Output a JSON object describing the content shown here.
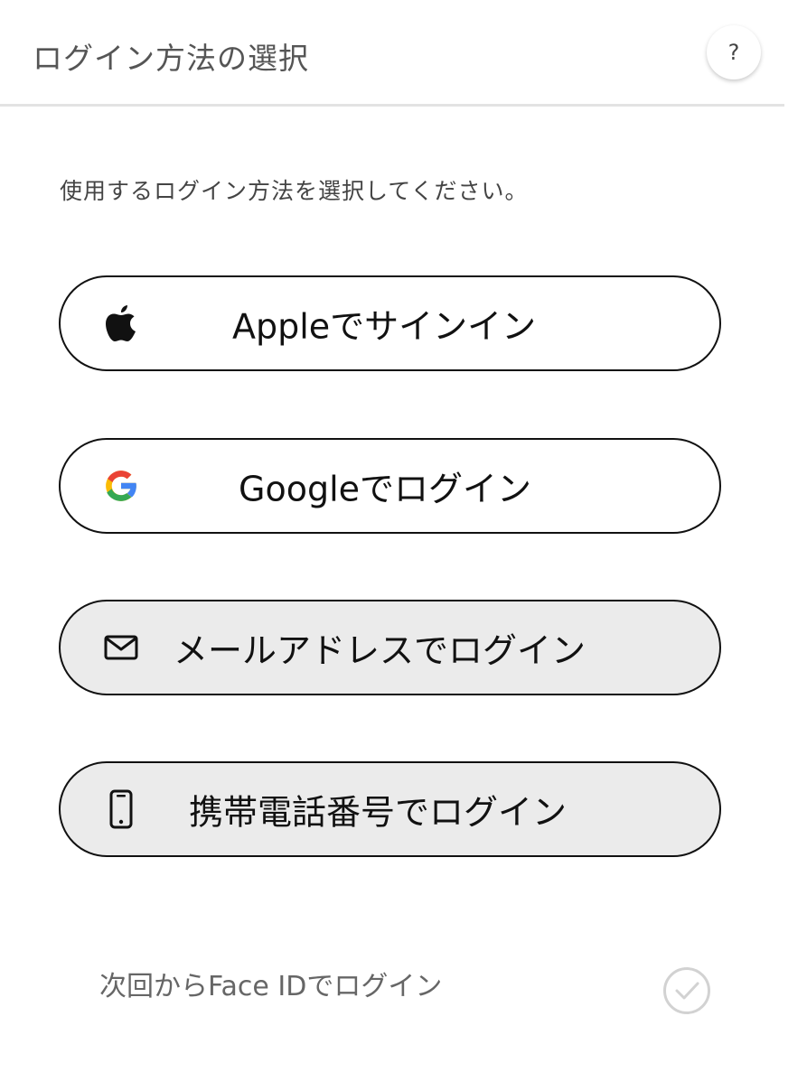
{
  "header": {
    "title": "ログイン方法の選択",
    "help_label": "?"
  },
  "instruction": "使用するログイン方法を選択してください。",
  "login_options": [
    {
      "label": "Appleでサインイン",
      "icon": "apple-icon"
    },
    {
      "label": "Googleでログイン",
      "icon": "google-icon"
    },
    {
      "label": "メールアドレスでログイン",
      "icon": "mail-icon"
    },
    {
      "label": "携帯電話番号でログイン",
      "icon": "phone-icon"
    }
  ],
  "faceid": {
    "label": "次回からFace IDでログイン",
    "checked": false,
    "icon": "checkmark-circle-icon"
  },
  "colors": {
    "border": "#111111",
    "gray_button": "#ebebeb",
    "google_blue": "#4285F4",
    "google_red": "#EA4335",
    "google_yellow": "#FBBC05",
    "google_green": "#34A853"
  }
}
